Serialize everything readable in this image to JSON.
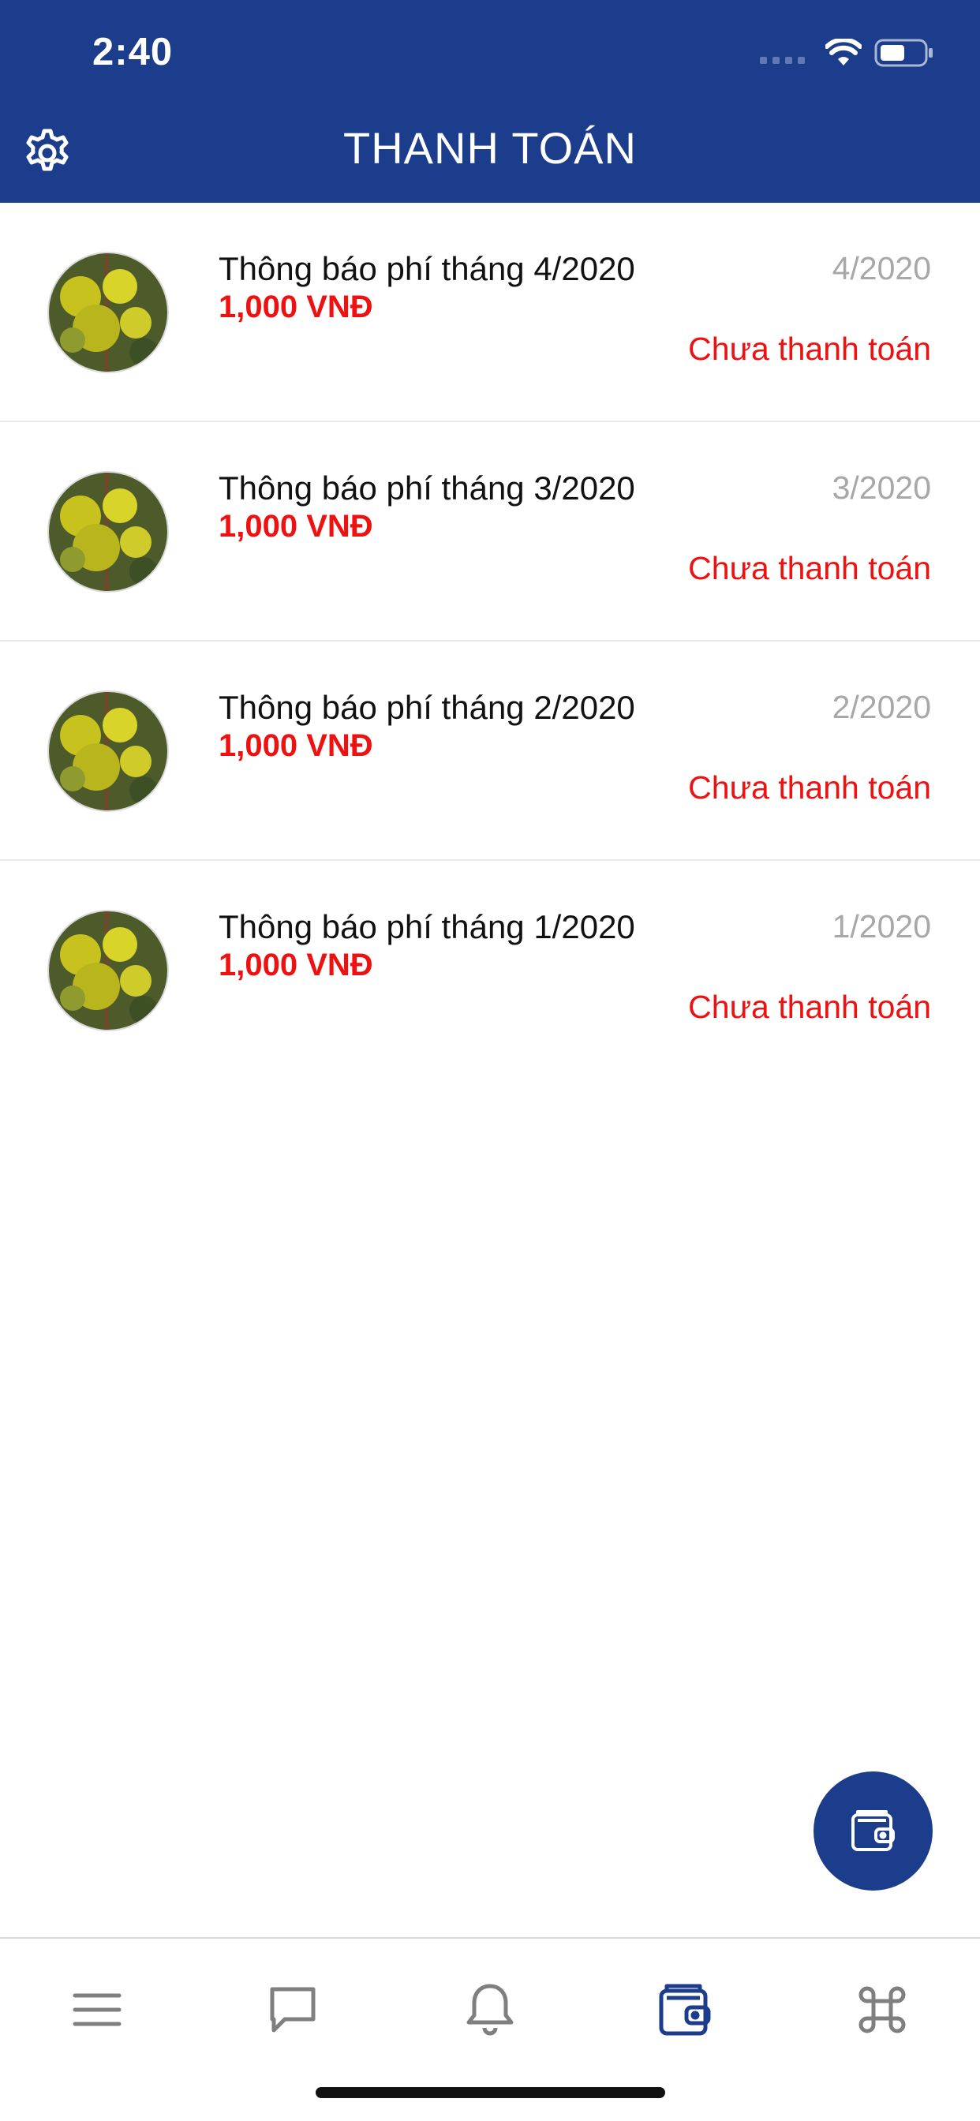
{
  "status_bar": {
    "time": "2:40"
  },
  "header": {
    "title": "THANH TOÁN",
    "settings_icon": "gear-icon"
  },
  "colors": {
    "brand": "#1c3c8c",
    "accent_red": "#ee1111",
    "muted": "#a8a8a8"
  },
  "payments": [
    {
      "title": "Thông báo phí tháng 4/2020",
      "amount": "1,000 VNĐ",
      "period": "4/2020",
      "status": "Chưa thanh toán"
    },
    {
      "title": "Thông báo phí tháng 3/2020",
      "amount": "1,000 VNĐ",
      "period": "3/2020",
      "status": "Chưa thanh toán"
    },
    {
      "title": "Thông báo phí tháng 2/2020",
      "amount": "1,000 VNĐ",
      "period": "2/2020",
      "status": "Chưa thanh toán"
    },
    {
      "title": "Thông báo phí tháng 1/2020",
      "amount": "1,000 VNĐ",
      "period": "1/2020",
      "status": "Chưa thanh toán"
    }
  ],
  "fab": {
    "icon": "wallet-icon"
  },
  "tabbar": {
    "tabs": [
      {
        "icon": "menu-icon",
        "active": false
      },
      {
        "icon": "chat-icon",
        "active": false
      },
      {
        "icon": "bell-icon",
        "active": false
      },
      {
        "icon": "wallet-icon",
        "active": true
      },
      {
        "icon": "command-icon",
        "active": false
      }
    ]
  }
}
